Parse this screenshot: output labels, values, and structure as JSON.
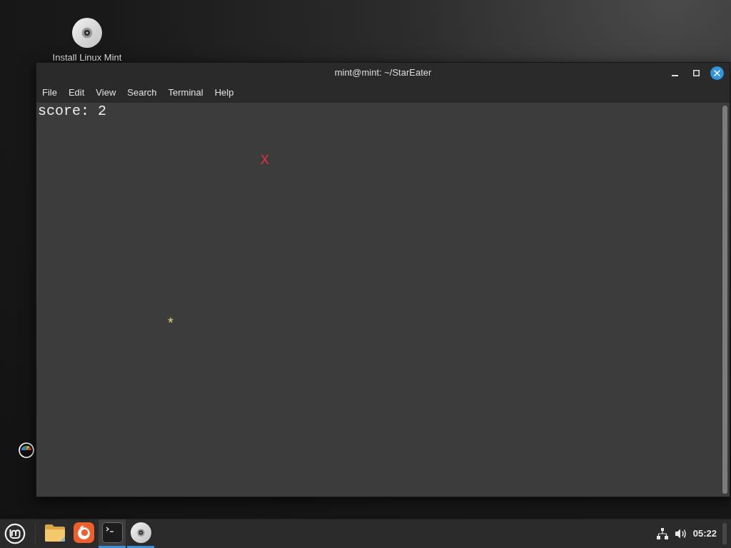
{
  "desktop": {
    "icons": [
      {
        "label": "Install Linux Mint"
      }
    ]
  },
  "window": {
    "title": "mint@mint: ~/StarEater",
    "menu": [
      "File",
      "Edit",
      "View",
      "Search",
      "Terminal",
      "Help"
    ]
  },
  "terminal": {
    "lines": [
      "score: 2"
    ],
    "sprites": [
      {
        "text": "X",
        "color": "#e0323c"
      },
      {
        "text": "*",
        "color": "#e6d27a"
      }
    ]
  },
  "taskbar": {
    "launchers": [
      {
        "kind": "folder",
        "running": false,
        "selected": false
      },
      {
        "kind": "swirl",
        "running": false,
        "selected": false
      },
      {
        "kind": "terminal",
        "running": true,
        "selected": true
      },
      {
        "kind": "disc",
        "running": true,
        "selected": false
      }
    ],
    "clock": "05:22"
  }
}
